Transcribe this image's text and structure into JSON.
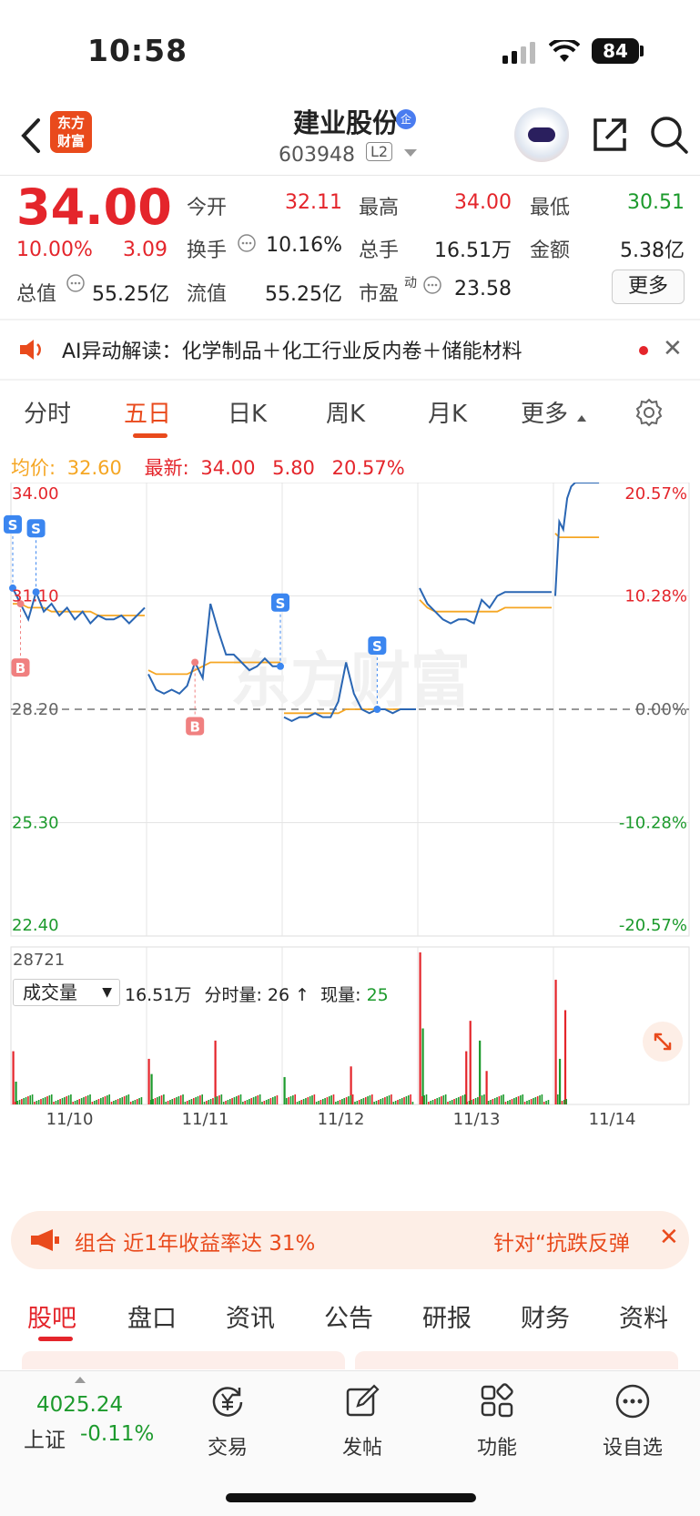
{
  "status_bar": {
    "time": "10:58",
    "battery": "84"
  },
  "header": {
    "logo_line1": "东方",
    "logo_line2": "财富",
    "stock_name": "建业股份",
    "badge": "企",
    "code": "603948",
    "level": "L2"
  },
  "quote": {
    "price": "34.00",
    "pct": "10.00%",
    "change": "3.09",
    "open_label": "今开",
    "open": "32.11",
    "high_label": "最高",
    "high": "34.00",
    "low_label": "最低",
    "low": "30.51",
    "turnover_label": "换手",
    "turnover": "10.16%",
    "volume_label": "总手",
    "volume": "16.51万",
    "amount_label": "金额",
    "amount": "5.38亿",
    "mktcap_label": "总值",
    "mktcap": "55.25亿",
    "float_label": "流值",
    "float": "55.25亿",
    "pe_label": "市盈",
    "pe_sup": "动",
    "pe": "23.58",
    "more_button": "更多"
  },
  "ticker": {
    "text": "AI异动解读：化学制品＋化工行业反内卷＋储能材料"
  },
  "chart_tabs": [
    "分时",
    "五日",
    "日K",
    "周K",
    "月K",
    "更多"
  ],
  "legend": {
    "avg_label": "均价:",
    "avg": "32.60",
    "latest_label": "最新:",
    "latest": "34.00",
    "latest_chg": "5.80",
    "latest_pct": "20.57%"
  },
  "chart_data": {
    "type": "line",
    "y_ticks_left": [
      "34.00",
      "31.10",
      "28.20",
      "25.30",
      "22.40"
    ],
    "y_ticks_right": [
      "20.57%",
      "10.28%",
      "0.00%",
      "-10.28%",
      "-20.57%"
    ],
    "ylim": [
      22.4,
      34.0
    ],
    "baseline": 28.2,
    "x_dates": [
      "11/10",
      "11/11",
      "11/12",
      "11/13",
      "11/14"
    ],
    "series": [
      {
        "values": [
          31.3,
          30.9,
          30.5,
          31.2,
          30.7,
          30.9,
          30.6,
          30.8,
          30.5,
          30.7,
          30.4,
          30.6,
          30.5,
          30.5,
          30.6,
          30.4,
          30.6,
          30.8,
          29.1,
          28.7,
          28.6,
          28.7,
          28.6,
          28.8,
          29.4,
          29.0,
          30.9,
          30.2,
          29.6,
          29.6,
          29.4,
          29.2,
          29.3,
          29.5,
          29.3,
          29.3,
          28.0,
          27.9,
          28.0,
          28.0,
          28.1,
          28.0,
          28.0,
          28.4,
          29.4,
          28.6,
          28.2,
          28.1,
          28.2,
          28.2,
          28.1,
          28.2,
          28.2,
          28.2,
          31.3,
          30.9,
          30.7,
          30.5,
          30.4,
          30.5,
          30.5,
          30.4,
          31.0,
          30.8,
          31.1,
          31.2,
          31.2,
          31.2,
          31.2,
          31.2,
          31.2,
          31.2,
          31.1,
          33.0,
          32.8,
          33.6,
          33.9,
          34.0,
          34.0,
          34.0,
          34.0,
          34.0,
          34.0,
          34.0
        ]
      },
      {
        "values": [
          30.9,
          30.9,
          30.8,
          30.8,
          30.8,
          30.7,
          30.7,
          30.7,
          30.7,
          30.7,
          30.7,
          30.6,
          30.6,
          30.6,
          30.6,
          30.6,
          30.6,
          30.6,
          29.2,
          29.1,
          29.1,
          29.1,
          29.1,
          29.1,
          29.2,
          29.3,
          29.4,
          29.4,
          29.4,
          29.4,
          29.4,
          29.4,
          29.4,
          29.4,
          29.4,
          29.4,
          28.1,
          28.1,
          28.1,
          28.1,
          28.1,
          28.1,
          28.1,
          28.1,
          28.2,
          28.2,
          28.2,
          28.2,
          28.2,
          28.2,
          28.2,
          28.2,
          28.2,
          28.2,
          31.0,
          30.8,
          30.7,
          30.7,
          30.7,
          30.7,
          30.7,
          30.7,
          30.7,
          30.7,
          30.7,
          30.8,
          30.8,
          30.8,
          30.8,
          30.8,
          30.8,
          30.8,
          32.7,
          32.6,
          32.6,
          32.6,
          32.6,
          32.6,
          32.6,
          32.6,
          32.6,
          32.6,
          32.6,
          32.6
        ]
      }
    ],
    "markers": [
      "S",
      "S",
      "B",
      "B",
      "S",
      "S"
    ]
  },
  "volume": {
    "selector": "成交量",
    "total": "16.51万",
    "min_label": "分时量:",
    "min_val": "26",
    "arrow": "↑",
    "now_label": "现量:",
    "now_val": "25",
    "max_tick": "28721",
    "x_dates": [
      "11/10",
      "11/11",
      "11/12",
      "11/13",
      "11/14"
    ]
  },
  "promo": {
    "left": "组合 近1年收益率达 31%",
    "right": "针对“抗跌反弹"
  },
  "sub_tabs": [
    "股吧",
    "盘口",
    "资讯",
    "公告",
    "研报",
    "财务",
    "资料"
  ],
  "bottom_nav": {
    "index_value": "4025.24",
    "index_name": "上证",
    "index_pct": "-0.11%",
    "trade": "交易",
    "post": "发帖",
    "functions": "功能",
    "watchlist": "设自选"
  },
  "colors": {
    "red": "#e4252b",
    "green": "#1c9a2c",
    "price_line": "#2a66b3",
    "avg_line": "#f5a623",
    "brand": "#e94a1c"
  }
}
